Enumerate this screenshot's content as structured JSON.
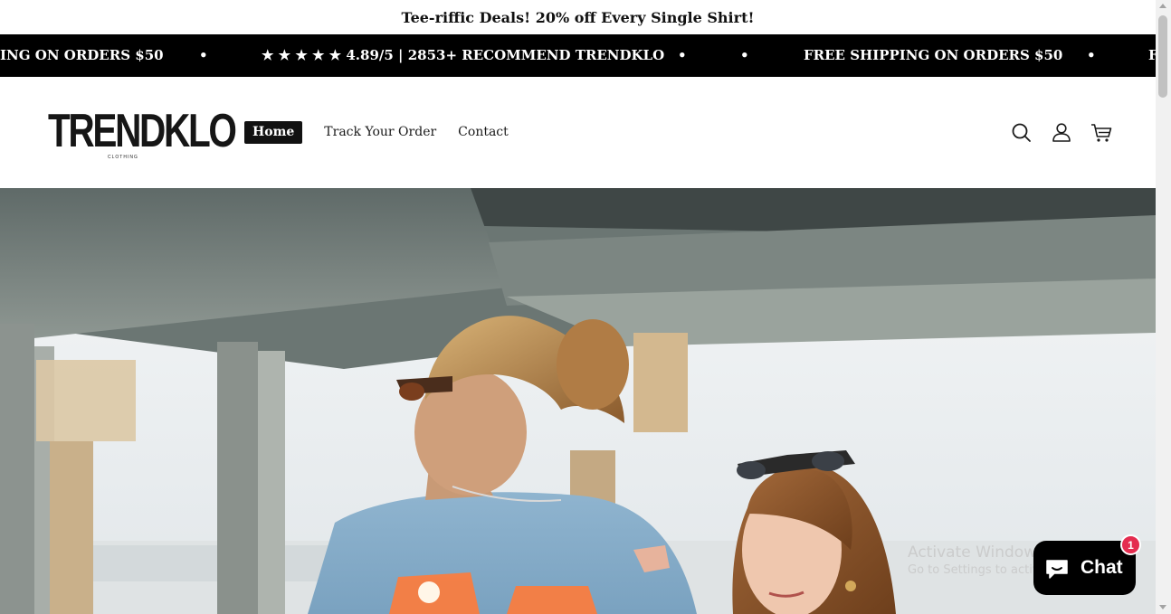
{
  "announcement": {
    "text": "Tee-riffic Deals! 20% off Every Single Shirt!"
  },
  "ticker": {
    "items": [
      "ING ON ORDERS $50",
      "•",
      "★ ★ ★ ★ ★ 4.89/5 | 2853+ RECOMMEND TRENDKLO",
      "•",
      "•",
      "FREE SHIPPING ON ORDERS $50",
      "•",
      "F"
    ]
  },
  "header": {
    "logo": {
      "name": "TRENDKLO",
      "tagline": "CLOTHING"
    },
    "nav": [
      {
        "label": "Home",
        "active": true
      },
      {
        "label": "Track Your Order",
        "active": false
      },
      {
        "label": "Contact",
        "active": false
      }
    ],
    "icons": [
      "search-icon",
      "account-icon",
      "cart-icon"
    ]
  },
  "hero": {
    "image": "couple-under-pier-photo"
  },
  "watermark": {
    "title": "Activate Windows",
    "subtitle": "Go to Settings to activate Windows."
  },
  "chat": {
    "label": "Chat",
    "badge": "1"
  },
  "colors": {
    "ticker_bg": "#000000",
    "badge": "#e42c4f",
    "active_nav_bg": "#111111"
  }
}
